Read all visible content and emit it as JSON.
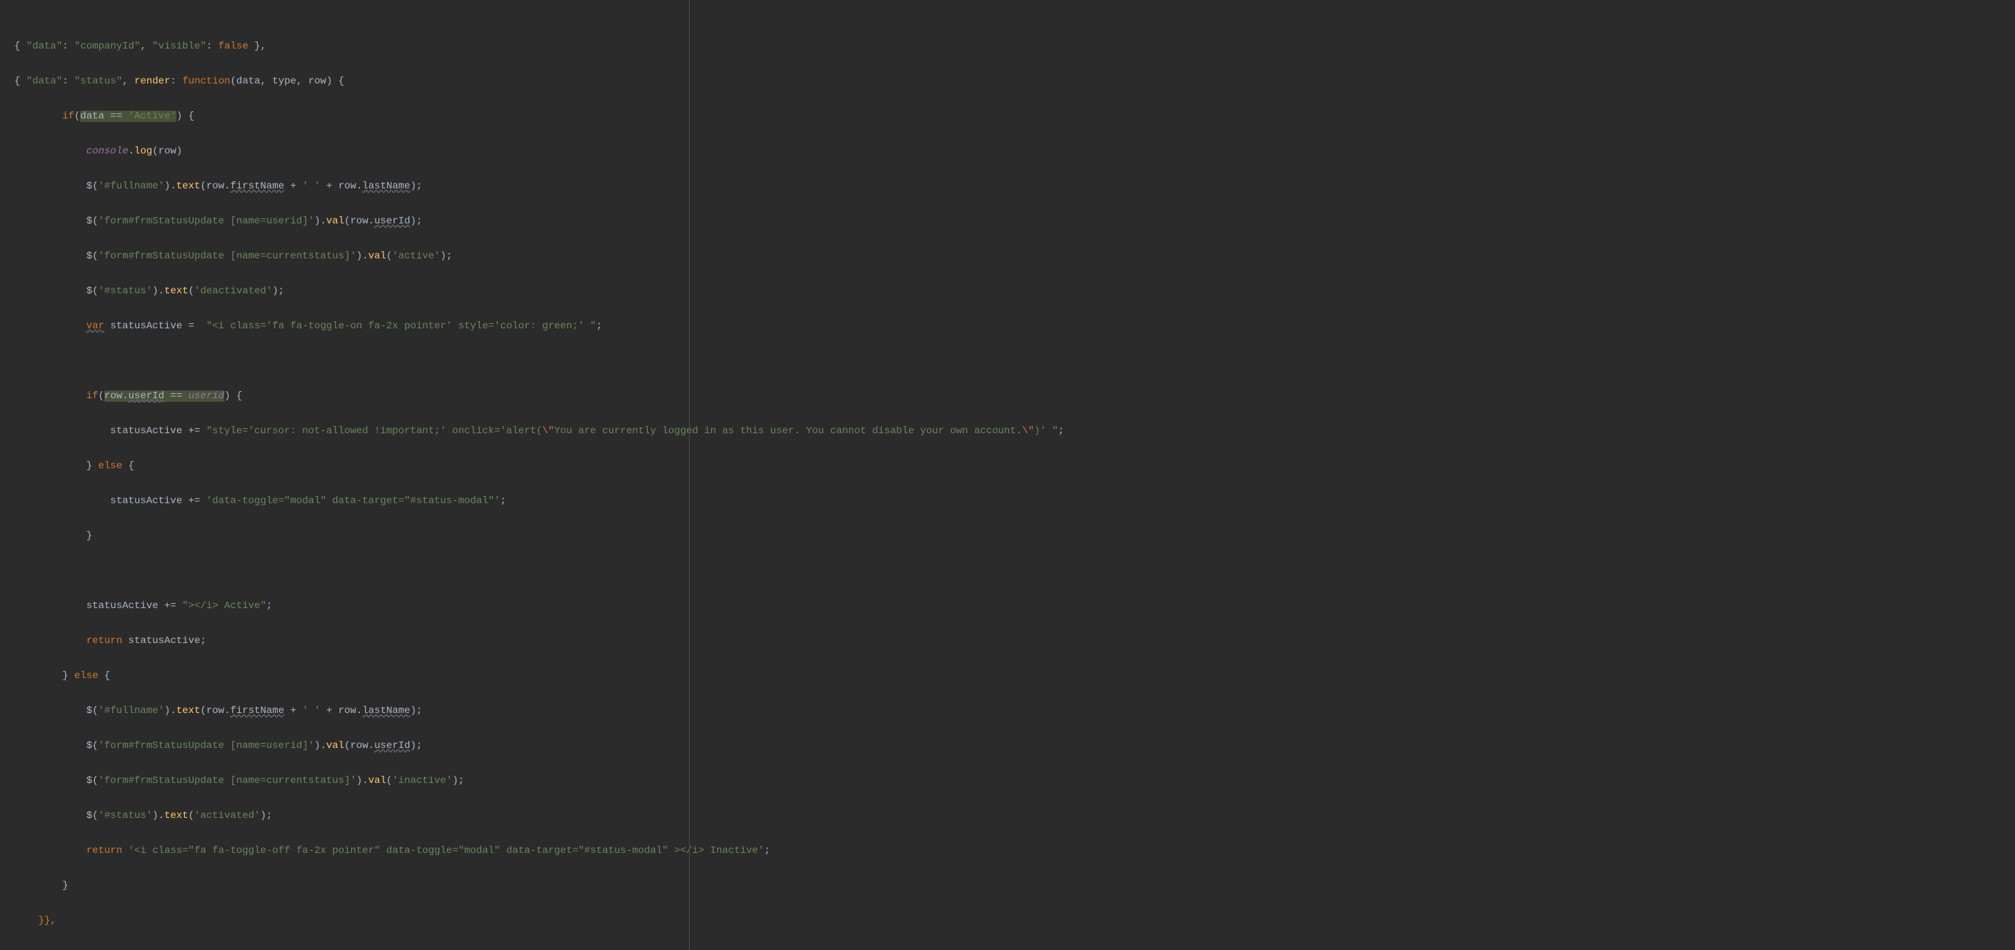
{
  "code": {
    "l0_a": "{ ",
    "l0_b": "\"data\"",
    "l0_c": ": ",
    "l0_d": "\"companyId\"",
    "l0_e": ", ",
    "l0_f": "\"visible\"",
    "l0_g": ": ",
    "l0_h": "false",
    "l0_i": " },",
    "l1_a": "{ ",
    "l1_b": "\"data\"",
    "l1_c": ": ",
    "l1_d": "\"status\"",
    "l1_e": ", ",
    "l1_f": "render",
    "l1_g": ": ",
    "l1_h": "function",
    "l1_i": "(data, type, row) {",
    "l2_a": "        if",
    "l2_b": "(",
    "l2_c": "data == ",
    "l2_d": "'Active'",
    "l2_e": ") {",
    "l3_a": "            ",
    "l3_b": "console",
    "l3_c": ".",
    "l3_d": "log",
    "l3_e": "(row)",
    "l4_a": "            $(",
    "l4_b": "'#fullname'",
    "l4_c": ").",
    "l4_d": "text",
    "l4_e": "(row.",
    "l4_f": "firstName",
    "l4_g": " + ",
    "l4_h": "' '",
    "l4_i": " + row.",
    "l4_j": "lastName",
    "l4_k": ");",
    "l5_a": "            $(",
    "l5_b": "'form#frmStatusUpdate [name=userid]'",
    "l5_c": ").",
    "l5_d": "val",
    "l5_e": "(row.",
    "l5_f": "userId",
    "l5_g": ");",
    "l6_a": "            $(",
    "l6_b": "'form#frmStatusUpdate [name=currentstatus]'",
    "l6_c": ").",
    "l6_d": "val",
    "l6_e": "(",
    "l6_f": "'active'",
    "l6_g": ");",
    "l7_a": "            $(",
    "l7_b": "'#status'",
    "l7_c": ").",
    "l7_d": "text",
    "l7_e": "(",
    "l7_f": "'deactivated'",
    "l7_g": ");",
    "l8_a": "            ",
    "l8_b": "var",
    "l8_c": " statusActive =  ",
    "l8_d": "\"<i class='fa fa-toggle-on fa-2x pointer' style='color: green;' \"",
    "l8_e": ";",
    "l10_a": "            ",
    "l10_b": "if",
    "l10_c": "(",
    "l10_d": "row.",
    "l10_e": "userId",
    "l10_f": " == ",
    "l10_g": "userid",
    "l10_h": ") {",
    "l11_a": "                statusActive += ",
    "l11_b": "\"style='cursor: not-allowed !important;' onclick='alert(",
    "l11_c": "\\\"",
    "l11_d": "You are currently logged in as this user. You cannot disable your own account.",
    "l11_e": "\\\"",
    "l11_f": ")' \"",
    "l11_g": ";",
    "l12_a": "            } ",
    "l12_b": "else",
    "l12_c": " {",
    "l13_a": "                statusActive += ",
    "l13_b": "'data-toggle=\"modal\" data-target=\"#status-modal\"'",
    "l13_c": ";",
    "l14_a": "            }",
    "l16_a": "            statusActive += ",
    "l16_b": "\"></i> Active\"",
    "l16_c": ";",
    "l17_a": "            ",
    "l17_b": "return",
    "l17_c": " statusActive;",
    "l18_a": "        } ",
    "l18_b": "else",
    "l18_c": " {",
    "l19_a": "            $(",
    "l19_b": "'#fullname'",
    "l19_c": ").",
    "l19_d": "text",
    "l19_e": "(row.",
    "l19_f": "firstName",
    "l19_g": " + ",
    "l19_h": "' '",
    "l19_i": " + row.",
    "l19_j": "lastName",
    "l19_k": ");",
    "l20_a": "            $(",
    "l20_b": "'form#frmStatusUpdate [name=userid]'",
    "l20_c": ").",
    "l20_d": "val",
    "l20_e": "(row.",
    "l20_f": "userId",
    "l20_g": ");",
    "l21_a": "            $(",
    "l21_b": "'form#frmStatusUpdate [name=currentstatus]'",
    "l21_c": ").",
    "l21_d": "val",
    "l21_e": "(",
    "l21_f": "'inactive'",
    "l21_g": ");",
    "l22_a": "            $(",
    "l22_b": "'#status'",
    "l22_c": ").",
    "l22_d": "text",
    "l22_e": "(",
    "l22_f": "'activated'",
    "l22_g": ");",
    "l23_a": "            ",
    "l23_b": "return",
    "l23_c": " ",
    "l23_d": "'<i class=\"fa fa-toggle-off fa-2x pointer\" data-toggle=\"modal\" data-target=\"#status-modal\" ></i> Inactive'",
    "l23_e": ";",
    "l24_a": "        }",
    "l25_a": "    }},"
  }
}
